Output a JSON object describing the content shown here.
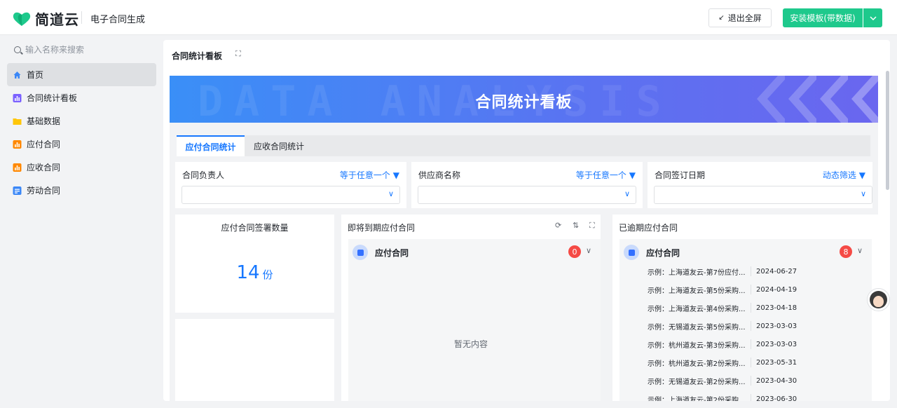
{
  "header": {
    "logo_text": "简道云",
    "app_name": "电子合同生成",
    "exit_label": "退出全屏",
    "install_label": "安装模板(带数据)"
  },
  "sidebar": {
    "search_placeholder": "输入名称来搜索",
    "items": [
      {
        "label": "首页",
        "icon": "home-icon",
        "color": "#3b87f7"
      },
      {
        "label": "合同统计看板",
        "icon": "dashboard-icon",
        "color": "#7b61ff"
      },
      {
        "label": "基础数据",
        "icon": "folder-icon",
        "color": "#ffc60a"
      },
      {
        "label": "应付合同",
        "icon": "form-icon",
        "color": "#ff8800"
      },
      {
        "label": "应收合同",
        "icon": "form-icon",
        "color": "#ff8800"
      },
      {
        "label": "劳动合同",
        "icon": "doc-icon",
        "color": "#3b87f7"
      }
    ]
  },
  "main": {
    "title": "合同统计看板",
    "banner_title": "合同统计看板",
    "banner_bg_text": "DATA ANALYSIS",
    "tabs": [
      "应付合同统计",
      "应收合同统计"
    ],
    "filters": [
      {
        "label": "合同负责人",
        "op": "等于任意一个"
      },
      {
        "label": "供应商名称",
        "op": "等于任意一个"
      },
      {
        "label": "合同签订日期",
        "op": "动态筛选"
      }
    ],
    "stat_card": {
      "title": "应付合同签署数量",
      "value": "14",
      "unit": "份"
    },
    "upcoming": {
      "title": "即将到期应付合同",
      "group": "应付合同",
      "count": "0",
      "empty": "暂无内容"
    },
    "overdue": {
      "title": "已逾期应付合同",
      "group": "应付合同",
      "count": "8",
      "rows": [
        {
          "name": "示例：上海道友云-第7份应付...",
          "date": "2024-06-27"
        },
        {
          "name": "示例：上海道友云-第5份采购...",
          "date": "2024-04-19"
        },
        {
          "name": "示例：上海道友云-第4份采购...",
          "date": "2023-04-18"
        },
        {
          "name": "示例：无锡道友云-第5份采购...",
          "date": "2023-03-03"
        },
        {
          "name": "示例：杭州道友云-第3份采购...",
          "date": "2023-03-03"
        },
        {
          "name": "示例：杭州道友云-第2份采购...",
          "date": "2023-05-31"
        },
        {
          "name": "示例：无锡道友云-第2份采购...",
          "date": "2023-04-30"
        },
        {
          "name": "示例：上海道友云-第2份采购...",
          "date": "2023-06-30"
        }
      ]
    }
  }
}
